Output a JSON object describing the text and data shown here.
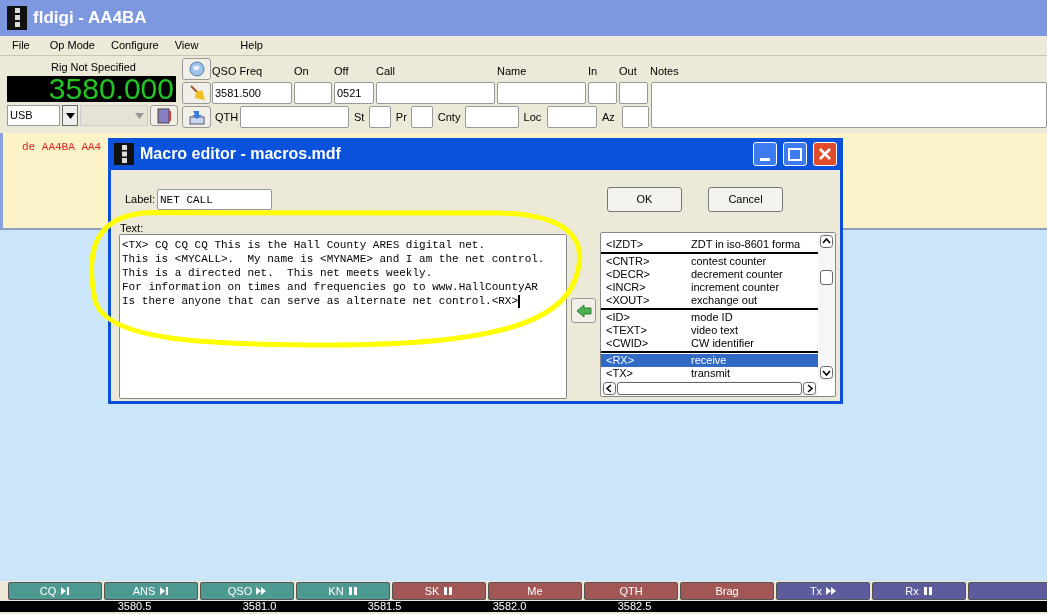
{
  "window": {
    "title": "fldigi - AA4BA"
  },
  "menu": [
    "File",
    "Op Mode",
    "Configure",
    "View",
    "Help"
  ],
  "rig": {
    "label": "Rig Not Specified",
    "frequency": "3580.000",
    "mode": "USB"
  },
  "log_fields": {
    "row_1": [
      {
        "label": "QSO Freq",
        "value": "3581.500"
      },
      {
        "label": "On"
      },
      {
        "label": "Off",
        "value": "0521"
      },
      {
        "label": "Call"
      },
      {
        "label": "Name"
      },
      {
        "label": "In"
      },
      {
        "label": "Out"
      },
      {
        "label": "Notes"
      }
    ],
    "row_2": [
      {
        "label": "QTH"
      },
      {
        "label": "St"
      },
      {
        "label": "Pr"
      },
      {
        "label": "Cnty"
      },
      {
        "label": "Loc"
      },
      {
        "label": "Az"
      }
    ]
  },
  "receive_text": "de AA4BA AA4",
  "dialog": {
    "title": "Macro editor - macros.mdf",
    "label_caption": "Label:",
    "label_value": "NET CALL",
    "ok": "OK",
    "cancel": "Cancel",
    "text_caption": "Text:",
    "text_lines": [
      "<TX> CQ CQ CQ This is the Hall County ARES digital net.",
      "This is <MYCALL>.  My name is <MYNAME> and I am the net control.",
      "This is a directed net.  This net meets weekly.",
      "For information on times and frequencies go to www.HallCountyAR",
      "Is there anyone that can serve as alternate net control.<RX>"
    ],
    "macro_groups": [
      [
        {
          "tag": "<IZDT>",
          "desc": "ZDT in iso-8601 forma",
          "selected": false
        }
      ],
      [
        {
          "tag": "<CNTR>",
          "desc": "contest counter",
          "selected": false
        },
        {
          "tag": "<DECR>",
          "desc": "decrement counter",
          "selected": false
        },
        {
          "tag": "<INCR>",
          "desc": "increment counter",
          "selected": false
        },
        {
          "tag": "<XOUT>",
          "desc": "exchange out",
          "selected": false
        }
      ],
      [
        {
          "tag": "<ID>",
          "desc": "mode ID",
          "selected": false
        },
        {
          "tag": "<TEXT>",
          "desc": "video text",
          "selected": false
        },
        {
          "tag": "<CWID>",
          "desc": "CW identifier",
          "selected": false
        }
      ],
      [
        {
          "tag": "<RX>",
          "desc": "receive",
          "selected": true
        },
        {
          "tag": "<TX>",
          "desc": "transmit",
          "selected": false
        }
      ]
    ]
  },
  "macro_buttons": [
    {
      "label": "CQ",
      "kind": "step",
      "color": "#4e9a93"
    },
    {
      "label": "ANS",
      "kind": "step",
      "color": "#4e9a93"
    },
    {
      "label": "QSO",
      "kind": "forward",
      "color": "#4e9a93"
    },
    {
      "label": "KN",
      "kind": "pause",
      "color": "#4e9a93"
    },
    {
      "label": "SK",
      "kind": "pause",
      "color": "#a35656"
    },
    {
      "label": "Me",
      "kind": "plain",
      "color": "#a35656"
    },
    {
      "label": "QTH",
      "kind": "plain",
      "color": "#a35656"
    },
    {
      "label": "Brag",
      "kind": "plain",
      "color": "#a35656"
    },
    {
      "label": "Tx",
      "kind": "forward",
      "color": "#5b5b9e"
    },
    {
      "label": "Rx",
      "kind": "pause",
      "color": "#5b5b9e"
    },
    {
      "kind": "plain",
      "color": "#5b5b9e"
    }
  ],
  "scale": [
    "3580.5",
    "3581.0",
    "3581.5",
    "3582.0",
    "3582.5"
  ]
}
